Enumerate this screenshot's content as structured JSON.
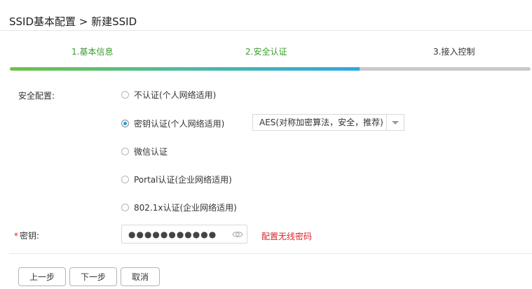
{
  "header": {
    "title": "SSID基本配置 > 新建SSID"
  },
  "steps": {
    "items": [
      "1.基本信息",
      "2.安全认证",
      "3.接入控制"
    ],
    "progress_fraction": 0.672
  },
  "security": {
    "label": "安全配置:",
    "options": [
      {
        "label": "不认证(个人网络适用)",
        "checked": false
      },
      {
        "label": "密钥认证(个人网络适用)",
        "checked": true
      },
      {
        "label": "微信认证",
        "checked": false
      },
      {
        "label": "Portal认证(企业网络适用)",
        "checked": false
      },
      {
        "label": "802.1x认证(企业网络适用)",
        "checked": false
      }
    ],
    "encryption_selected": "AES(对称加密算法，安全，推荐)"
  },
  "key": {
    "required_mark": "*",
    "label": "密钥:",
    "masked_value": "●●●●●●●●●●●",
    "hint": "配置无线密码"
  },
  "buttons": {
    "prev": "上一步",
    "next": "下一步",
    "cancel": "取消"
  },
  "colors": {
    "step_done": "#3a9c2e",
    "radio_dot": "#1f9fe0",
    "hint": "#d8262b",
    "required": "#e2231a"
  }
}
